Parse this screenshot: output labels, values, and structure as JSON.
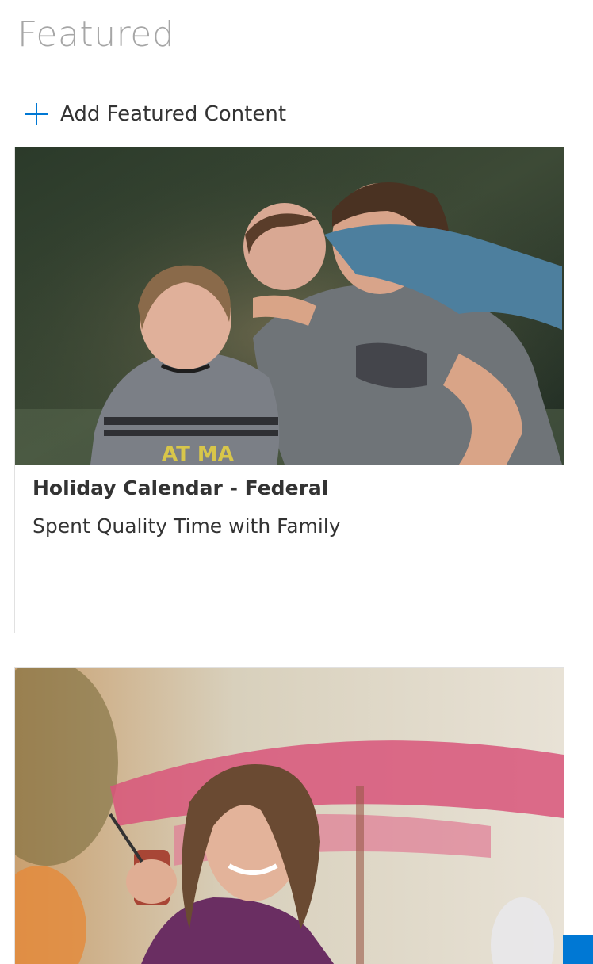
{
  "section": {
    "title": "Featured",
    "add_label": "Add Featured Content"
  },
  "cards": [
    {
      "title": "Holiday Calendar - Federal",
      "subtitle": "Spent Quality Time with Family",
      "image_icon": "family-photo"
    },
    {
      "title": "",
      "subtitle": "",
      "image_icon": "woman-with-drink-photo"
    }
  ],
  "colors": {
    "accent": "#0078d4",
    "title_gray": "#a6a6a6",
    "text": "#333333",
    "card_border": "#e1e1e1"
  }
}
